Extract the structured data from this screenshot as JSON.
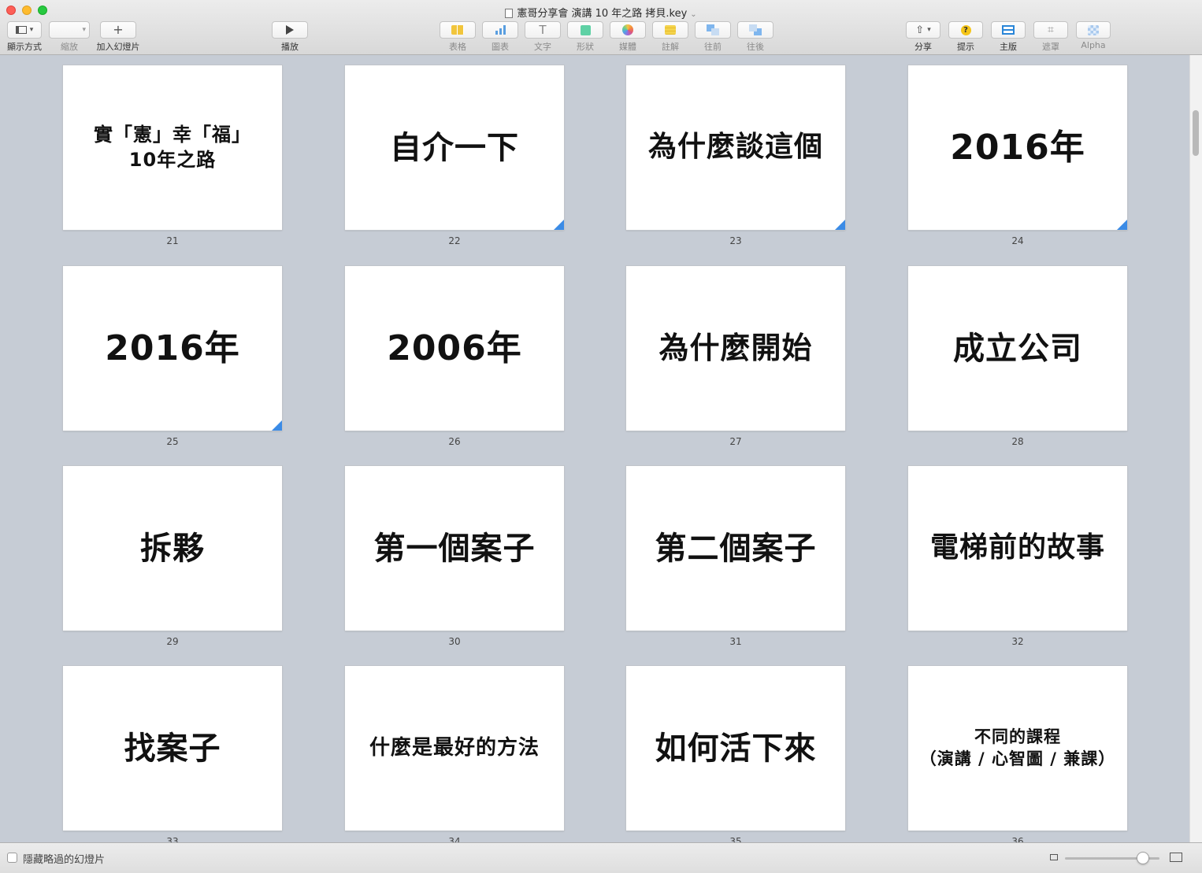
{
  "window": {
    "title": "憲哥分享會 演講 10 年之路 拷貝.key"
  },
  "toolbar": {
    "view_label": "顯示方式",
    "zoom_label": "縮放",
    "add_slide_label": "加入幻燈片",
    "play_label": "播放",
    "table_label": "表格",
    "chart_label": "圖表",
    "text_label": "文字",
    "shape_label": "形狀",
    "media_label": "媒體",
    "comment_label": "註解",
    "forward_label": "往前",
    "backward_label": "往後",
    "share_label": "分享",
    "tips_label": "提示",
    "master_label": "主版",
    "mask_label": "遮罩",
    "alpha_label": "Alpha"
  },
  "icons": {
    "view": "sidebar-layout-icon",
    "add": "plus-icon",
    "play": "play-triangle-icon",
    "share": "share-icon",
    "tips": "question-icon"
  },
  "slides": [
    {
      "number": "21",
      "line1": "實「憲」幸「福」",
      "line2": "10年之路",
      "size": 24,
      "skipped": false
    },
    {
      "number": "22",
      "line1": "自介一下",
      "line2": "",
      "size": 40,
      "skipped": true
    },
    {
      "number": "23",
      "line1": "為什麼談這個",
      "line2": "",
      "size": 36,
      "skipped": true
    },
    {
      "number": "24",
      "line1": "2016年",
      "line2": "",
      "size": 44,
      "skipped": true
    },
    {
      "number": "25",
      "line1": "2016年",
      "line2": "",
      "size": 44,
      "skipped": true
    },
    {
      "number": "26",
      "line1": "2006年",
      "line2": "",
      "size": 44,
      "skipped": false
    },
    {
      "number": "27",
      "line1": "為什麼開始",
      "line2": "",
      "size": 38,
      "skipped": false
    },
    {
      "number": "28",
      "line1": "成立公司",
      "line2": "",
      "size": 40,
      "skipped": false
    },
    {
      "number": "29",
      "line1": "拆夥",
      "line2": "",
      "size": 40,
      "skipped": false
    },
    {
      "number": "30",
      "line1": "第一個案子",
      "line2": "",
      "size": 40,
      "skipped": false
    },
    {
      "number": "31",
      "line1": "第二個案子",
      "line2": "",
      "size": 40,
      "skipped": false
    },
    {
      "number": "32",
      "line1": "電梯前的故事",
      "line2": "",
      "size": 36,
      "skipped": false
    },
    {
      "number": "33",
      "line1": "找案子",
      "line2": "",
      "size": 40,
      "skipped": false
    },
    {
      "number": "34",
      "line1": "什麼是最好的方法",
      "line2": "",
      "size": 26,
      "skipped": false
    },
    {
      "number": "35",
      "line1": "如何活下來",
      "line2": "",
      "size": 40,
      "skipped": false
    },
    {
      "number": "36",
      "line1": "不同的課程",
      "line2": "（演講 / 心智圖 / 兼課）",
      "size": 21,
      "skipped": false
    }
  ],
  "bottombar": {
    "hide_skipped_label": "隱藏略過的幻燈片"
  },
  "colors": {
    "background": "#c6ccd5",
    "skip_marker": "#3b8be6"
  }
}
